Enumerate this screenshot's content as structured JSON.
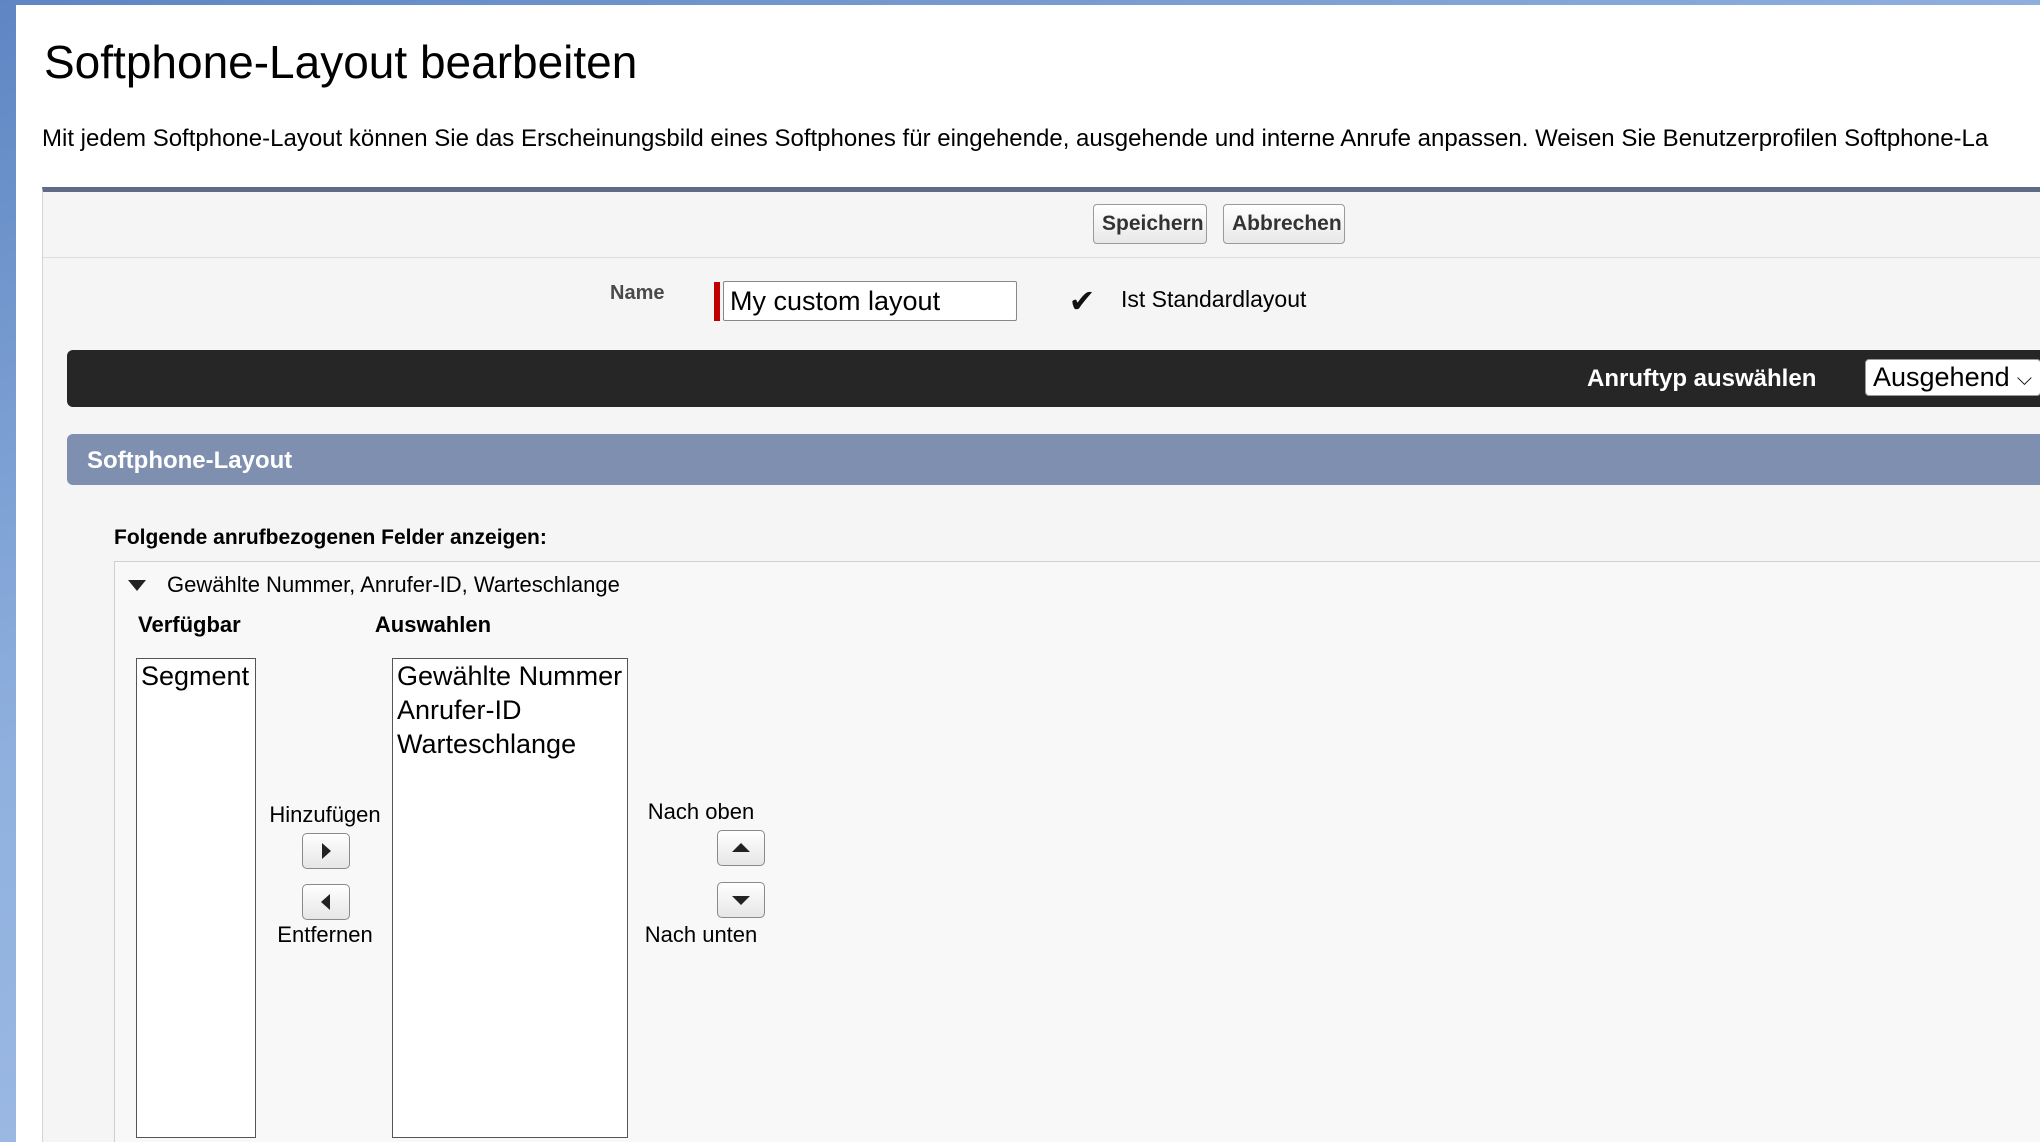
{
  "page": {
    "title": "Softphone-Layout bearbeiten",
    "description": "Mit jedem Softphone-Layout können Sie das Erscheinungsbild eines Softphones für eingehende, ausgehende und interne Anrufe anpassen. Weisen Sie Benutzerprofilen Softphone-La"
  },
  "toolbar": {
    "save_label": "Speichern",
    "cancel_label": "Abbrechen"
  },
  "form": {
    "name_label": "Name",
    "name_value": "My custom layout",
    "default_checked": true,
    "default_label": "Ist Standardlayout"
  },
  "calltype": {
    "label": "Anruftyp auswählen",
    "selected": "Ausgehend"
  },
  "section": {
    "title": "Softphone-Layout",
    "fields_label": "Folgende anrufbezogenen Felder anzeigen:",
    "group_title": "Gewählte Nummer, Anrufer-ID, Warteschlange",
    "available_header": "Verfügbar",
    "selected_header": "Auswahlen",
    "available_items": [
      "Segment"
    ],
    "selected_items": [
      "Gewählte Nummer",
      "Anrufer-ID",
      "Warteschlange"
    ],
    "add_label": "Hinzufügen",
    "remove_label": "Entfernen",
    "up_label": "Nach oben",
    "down_label": "Nach unten"
  },
  "icons": {
    "check": "check-icon",
    "collapse": "triangle-down-icon",
    "add": "triangle-right-icon",
    "remove": "triangle-left-icon",
    "up": "triangle-up-icon",
    "down": "triangle-down-icon",
    "dropdown": "chevron-down-icon"
  },
  "colors": {
    "required": "#c00000",
    "calltype_bar": "#262626",
    "section_header": "#7f8fb0",
    "panel_border": "#5f6c86"
  }
}
